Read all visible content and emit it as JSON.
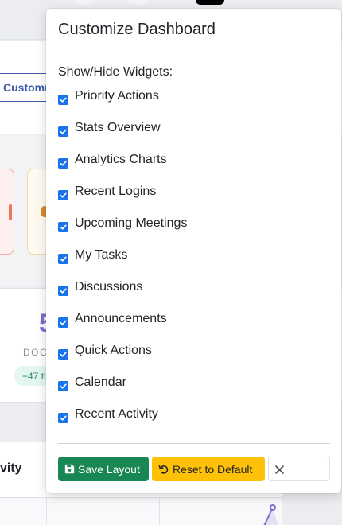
{
  "background": {
    "customize_button_label": "Customize",
    "stat_number": "5",
    "stat_label": "DOC",
    "stat_badge": "+47 th",
    "activity_title": "vity"
  },
  "panel": {
    "title": "Customize Dashboard",
    "section_label": "Show/Hide Widgets:",
    "widgets": [
      {
        "label": "Priority Actions",
        "checked": true
      },
      {
        "label": "Stats Overview",
        "checked": true
      },
      {
        "label": "Analytics Charts",
        "checked": true
      },
      {
        "label": "Recent Logins",
        "checked": true
      },
      {
        "label": "Upcoming Meetings",
        "checked": true
      },
      {
        "label": "My Tasks",
        "checked": true
      },
      {
        "label": "Discussions",
        "checked": true
      },
      {
        "label": "Announcements",
        "checked": true
      },
      {
        "label": "Quick Actions",
        "checked": true
      },
      {
        "label": "Calendar",
        "checked": true
      },
      {
        "label": "Recent Activity",
        "checked": true
      }
    ],
    "buttons": {
      "save_label": "Save Layout",
      "save_icon": "floppy-disk-icon",
      "reset_label": "Reset to Default",
      "reset_icon": "undo-icon",
      "close_icon": "close-icon"
    }
  },
  "colors": {
    "checkbox": "#1a73e8",
    "save": "#198754",
    "reset": "#ffc107",
    "accent_purple": "#7b6fd0"
  }
}
